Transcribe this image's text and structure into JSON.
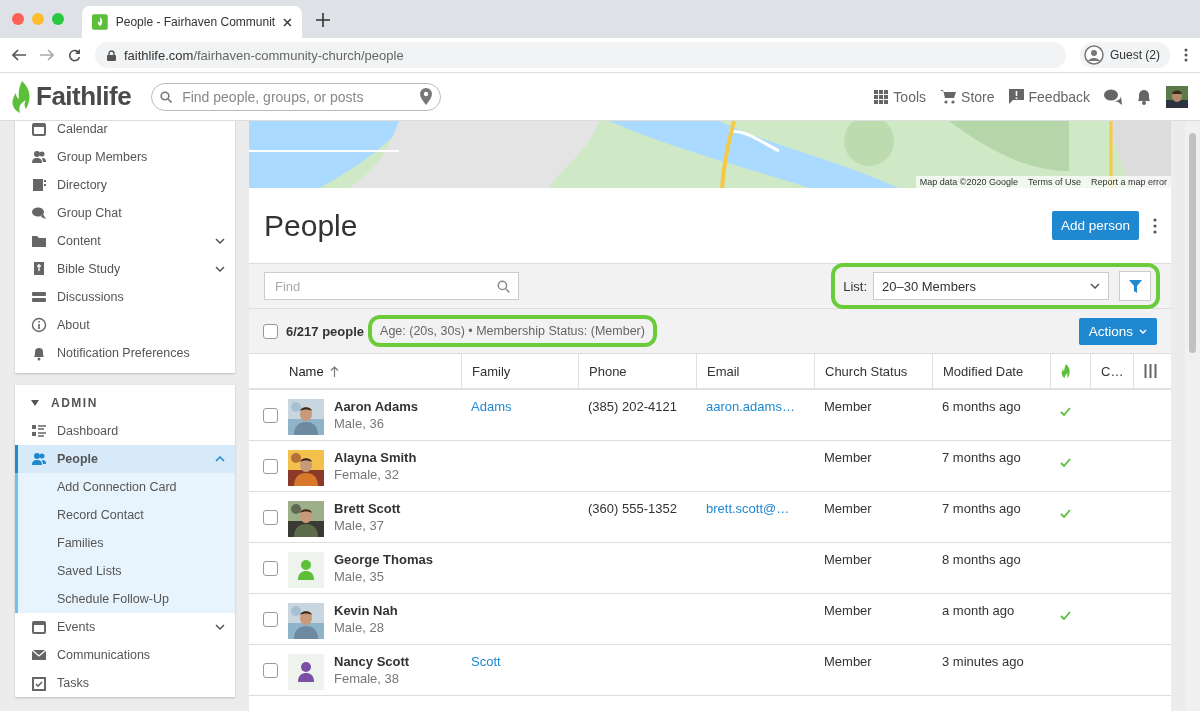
{
  "browser": {
    "tab_title": "People - Fairhaven Communit",
    "url_domain": "faithlife.com",
    "url_path": "/fairhaven-community-church/people",
    "profile": "Guest (2)"
  },
  "header": {
    "logo": "Faithlife",
    "search_placeholder": "Find people, groups, or posts",
    "nav": [
      "Tools",
      "Store",
      "Feedback"
    ]
  },
  "sidebar": {
    "items": [
      {
        "label": "Calendar",
        "expandable": false
      },
      {
        "label": "Group Members",
        "expandable": false
      },
      {
        "label": "Directory",
        "expandable": false
      },
      {
        "label": "Group Chat",
        "expandable": false
      },
      {
        "label": "Content",
        "expandable": true
      },
      {
        "label": "Bible Study",
        "expandable": true
      },
      {
        "label": "Discussions",
        "expandable": false
      },
      {
        "label": "About",
        "expandable": false
      },
      {
        "label": "Notification Preferences",
        "expandable": false
      }
    ],
    "admin": {
      "title": "ADMIN",
      "expanded": true,
      "items": [
        {
          "label": "Dashboard",
          "selected": false,
          "expandable": false
        },
        {
          "label": "People",
          "selected": true,
          "expandable": true,
          "expanded": true,
          "children": [
            {
              "label": "Add Connection Card"
            },
            {
              "label": "Record Contact"
            },
            {
              "label": "Families"
            },
            {
              "label": "Saved Lists"
            },
            {
              "label": "Schedule Follow-Up"
            }
          ]
        },
        {
          "label": "Events",
          "selected": false,
          "expandable": true,
          "expanded": false
        },
        {
          "label": "Communications",
          "selected": false,
          "expandable": false
        },
        {
          "label": "Tasks",
          "selected": false,
          "expandable": false
        }
      ]
    }
  },
  "map": {
    "kind": "picture",
    "attribution": [
      "Map data ©2020 Google",
      "Terms of Use",
      "Report a map error"
    ]
  },
  "page": {
    "title": "People",
    "add_button": "Add person"
  },
  "toolbar": {
    "find_placeholder": "Find",
    "list_label": "List:",
    "list_value": "20–30 Members",
    "highlighted": true
  },
  "summary": {
    "count": "6/217 people",
    "filters": "Age: (20s, 30s) • Membership Status: (Member)",
    "highlighted": true,
    "all_checked": false,
    "actions": "Actions"
  },
  "table": {
    "columns": [
      {
        "label": "Name",
        "sorted": true
      },
      {
        "label": "Family",
        "sorted": false
      },
      {
        "label": "Phone",
        "sorted": false
      },
      {
        "label": "Email",
        "sorted": false
      },
      {
        "label": "Church Status",
        "sorted": false
      },
      {
        "label": "Modified Date",
        "sorted": false
      },
      {
        "kind": "icon",
        "sorted": false
      },
      {
        "label": "C…",
        "sorted": false
      }
    ],
    "rows": [
      {
        "name": "Aaron Adams",
        "detail": "Male, 36",
        "family": "Adams",
        "phone": "(385) 202-4121",
        "email": "aaron.adams…",
        "status": "Member",
        "modified": "6 months ago",
        "synced": true,
        "checked": false
      },
      {
        "name": "Alayna Smith",
        "detail": "Female, 32",
        "family": "",
        "phone": "",
        "email": "",
        "status": "Member",
        "modified": "7 months ago",
        "synced": true,
        "checked": false
      },
      {
        "name": "Brett Scott",
        "detail": "Male, 37",
        "family": "",
        "phone": "(360) 555-1352",
        "email": "brett.scott@…",
        "status": "Member",
        "modified": "7 months ago",
        "synced": true,
        "checked": false
      },
      {
        "name": "George Thomas",
        "detail": "Male, 35",
        "avatar": {
          "kind": "default",
          "color": "#5bbf3a"
        },
        "family": "",
        "phone": "",
        "email": "",
        "status": "Member",
        "modified": "8 months ago",
        "synced": false,
        "checked": false
      },
      {
        "name": "Kevin Nah",
        "detail": "Male, 28",
        "family": "",
        "phone": "",
        "email": "",
        "status": "Member",
        "modified": "a month ago",
        "synced": true,
        "checked": false
      },
      {
        "name": "Nancy Scott",
        "detail": "Female, 38",
        "avatar": {
          "kind": "default",
          "color": "#7b4fa8"
        },
        "family": "Scott",
        "phone": "",
        "email": "",
        "status": "Member",
        "modified": "3 minutes ago",
        "synced": false,
        "checked": false
      }
    ]
  }
}
